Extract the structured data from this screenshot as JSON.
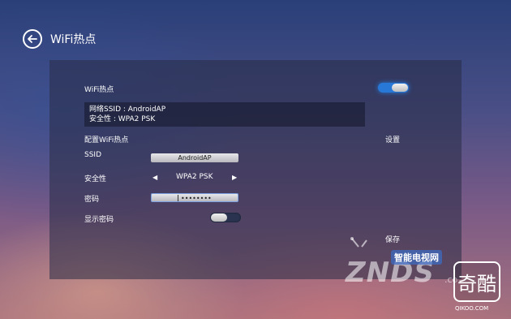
{
  "header": {
    "title": "WiFi热点"
  },
  "hotspot": {
    "label": "WiFi热点",
    "enabled": true
  },
  "info": {
    "ssid_line": "网络SSID : AndroidAP",
    "security_line": "安全性 : WPA2 PSK"
  },
  "config": {
    "section_label": "配置WiFi热点",
    "settings_label": "设置",
    "ssid_label": "SSID",
    "ssid_value": "AndroidAP",
    "security_label": "安全性",
    "security_value": "WPA2 PSK",
    "password_label": "密码",
    "password_value": "••••••••",
    "show_password_label": "显示密码",
    "show_password_enabled": false,
    "save_label": "保存"
  },
  "watermark": {
    "brand": "ZNDS",
    "brand_cn": "智能电视网",
    "suffix": ".co",
    "logo_text": "奇酷",
    "domain": "QIKOO.COM"
  }
}
